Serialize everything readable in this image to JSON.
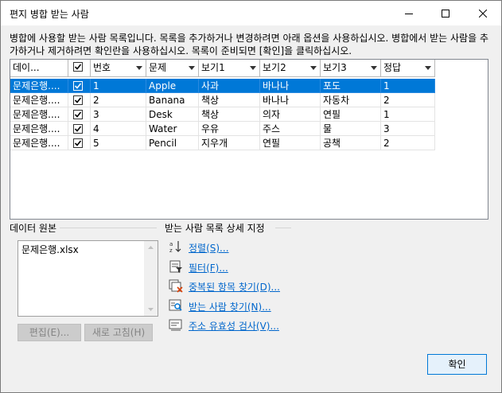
{
  "window": {
    "title": "편지 병합 받는 사람"
  },
  "description": "병합에 사용할 받는 사람 목록입니다. 목록을 추가하거나 변경하려면 아래 옵션을 사용하십시오. 병합에서 받는 사람을 추가하거나 제거하려면 확인란을 사용하십시오. 목록이 준비되면 [확인]을 클릭하십시오.",
  "table": {
    "headers": [
      "데이...",
      "",
      "번호",
      "문제",
      "보기1",
      "보기2",
      "보기3",
      "정답"
    ],
    "rows": [
      {
        "source": "문제은행....",
        "checked": true,
        "no": "1",
        "q": "Apple",
        "v1": "사과",
        "v2": "바나나",
        "v3": "포도",
        "ans": "1"
      },
      {
        "source": "문제은행....",
        "checked": true,
        "no": "2",
        "q": "Banana",
        "v1": "책상",
        "v2": "바나나",
        "v3": "자동차",
        "ans": "2"
      },
      {
        "source": "문제은행....",
        "checked": true,
        "no": "3",
        "q": "Desk",
        "v1": "책상",
        "v2": "의자",
        "v3": "연필",
        "ans": "1"
      },
      {
        "source": "문제은행....",
        "checked": true,
        "no": "4",
        "q": "Water",
        "v1": "우유",
        "v2": "주스",
        "v3": "물",
        "ans": "3"
      },
      {
        "source": "문제은행....",
        "checked": true,
        "no": "5",
        "q": "Pencil",
        "v1": "지우개",
        "v2": "연필",
        "v3": "공책",
        "ans": "2"
      }
    ]
  },
  "data_source": {
    "group_title": "데이터 원본",
    "items": [
      "문제은행.xlsx"
    ],
    "edit_label": "편집(E)...",
    "refresh_label": "새로 고침(H)"
  },
  "refine": {
    "group_title": "받는 사람 목록 상세 지정",
    "links": [
      {
        "label": "정렬(S)...",
        "icon": "sort-icon"
      },
      {
        "label": "필터(F)...",
        "icon": "filter-icon"
      },
      {
        "label": "중복된 항목 찾기(D)...",
        "icon": "duplicates-icon"
      },
      {
        "label": "받는 사람 찾기(N)...",
        "icon": "find-recipient-icon"
      },
      {
        "label": "주소 유효성 검사(V)...",
        "icon": "validate-address-icon"
      }
    ]
  },
  "ok_label": "확인",
  "colors": {
    "selection": "#0078d7",
    "link": "#0066cc"
  }
}
